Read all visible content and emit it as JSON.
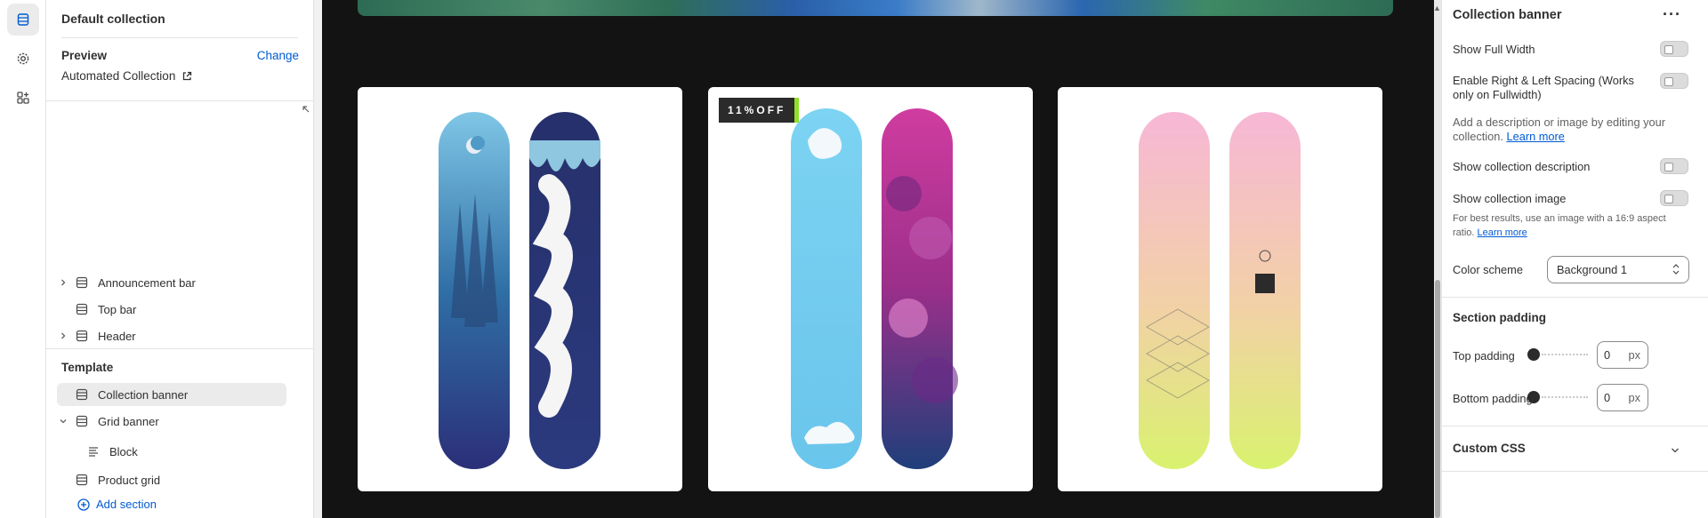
{
  "left_panel": {
    "title": "Default collection",
    "preview_label": "Preview",
    "change_label": "Change",
    "collection_name": "Automated Collection",
    "header_items": [
      {
        "label": "Announcement bar",
        "expandable": true
      },
      {
        "label": "Top bar",
        "expandable": false
      },
      {
        "label": "Header",
        "expandable": true
      }
    ],
    "template_heading": "Template",
    "template_items": [
      {
        "label": "Collection banner",
        "selected": true
      },
      {
        "label": "Grid banner",
        "expanded": true
      },
      {
        "label": "Block",
        "child": true
      },
      {
        "label": "Product grid"
      }
    ],
    "add_section_label": "Add section"
  },
  "preview": {
    "badge_text": "11%OFF"
  },
  "right_panel": {
    "title": "Collection banner",
    "show_full_width": "Show Full Width",
    "enable_spacing": "Enable Right & Left Spacing (Works only on Fullwidth)",
    "description_help_text": "Add a description or image by editing your collection.",
    "learn_more": "Learn more",
    "show_description": "Show collection description",
    "show_image": "Show collection image",
    "image_help_text": "For best results, use an image with a 16:9 aspect ratio.",
    "color_scheme_label": "Color scheme",
    "color_scheme_value": "Background 1",
    "section_padding_heading": "Section padding",
    "top_padding_label": "Top padding",
    "top_padding_value": "0",
    "bottom_padding_label": "Bottom padding",
    "bottom_padding_value": "0",
    "unit": "px",
    "custom_css_label": "Custom CSS"
  },
  "colors": {
    "accent_link": "#005bd3",
    "badge_bg": "#2b2b2b",
    "badge_accent": "#8ee02a"
  }
}
